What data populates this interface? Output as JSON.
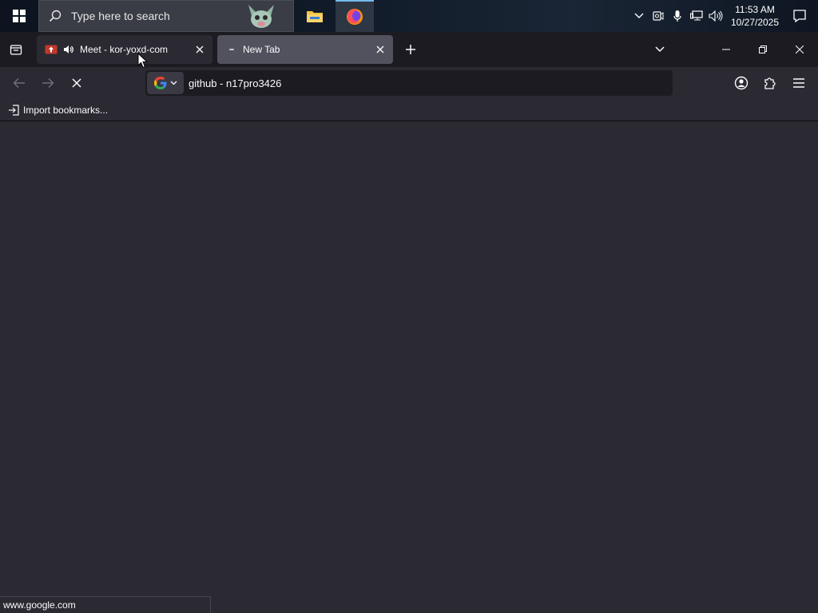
{
  "taskbar": {
    "search_placeholder": "Type here to search",
    "clock_time": "11:53 AM",
    "clock_date": "10/27/2025",
    "apps": [
      "file-explorer",
      "firefox"
    ]
  },
  "tabs": [
    {
      "title": "Meet - kor-yoxd-com",
      "active": false,
      "audio": true
    },
    {
      "title": "New Tab",
      "active": true,
      "loading": true
    }
  ],
  "urlbar": {
    "value": "github - n17pro3426",
    "search_engine": "Google"
  },
  "bookmarks": {
    "import_label": "Import bookmarks..."
  },
  "status": {
    "text": "www.google.com"
  },
  "colors": {
    "chrome_bg": "#1c1b22",
    "toolbar_bg": "#2b2a33",
    "active_tab": "#52525e",
    "text": "#fbfbfe"
  }
}
